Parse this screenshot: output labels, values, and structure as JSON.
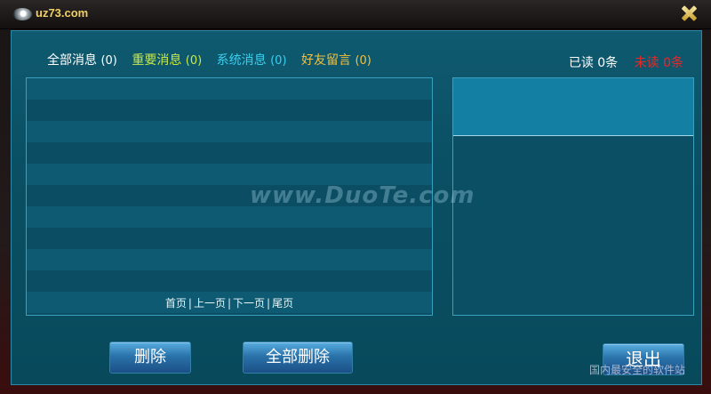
{
  "window": {
    "title": "uz73.com"
  },
  "tabs": [
    {
      "label": "全部消息",
      "count": "(0)",
      "color": "#ffffff"
    },
    {
      "label": "重要消息",
      "count": "(0)",
      "color": "#c8e84a"
    },
    {
      "label": "系统消息",
      "count": "(0)",
      "color": "#39d0f0"
    },
    {
      "label": "好友留言",
      "count": "(0)",
      "color": "#f0c040"
    }
  ],
  "stats": {
    "read": "已读 0条",
    "unread": "未读 0条",
    "read_color": "#ffffff",
    "unread_color": "#e82828"
  },
  "pager": {
    "first": "首页",
    "prev": "上一页",
    "next": "下一页",
    "last": "尾页",
    "separator": "|"
  },
  "watermark": "www.DuoTe.com",
  "buttons": {
    "delete": "删除",
    "delete_all": "全部删除",
    "exit": "退出"
  },
  "site_watermark": "国内最安全的软件站"
}
